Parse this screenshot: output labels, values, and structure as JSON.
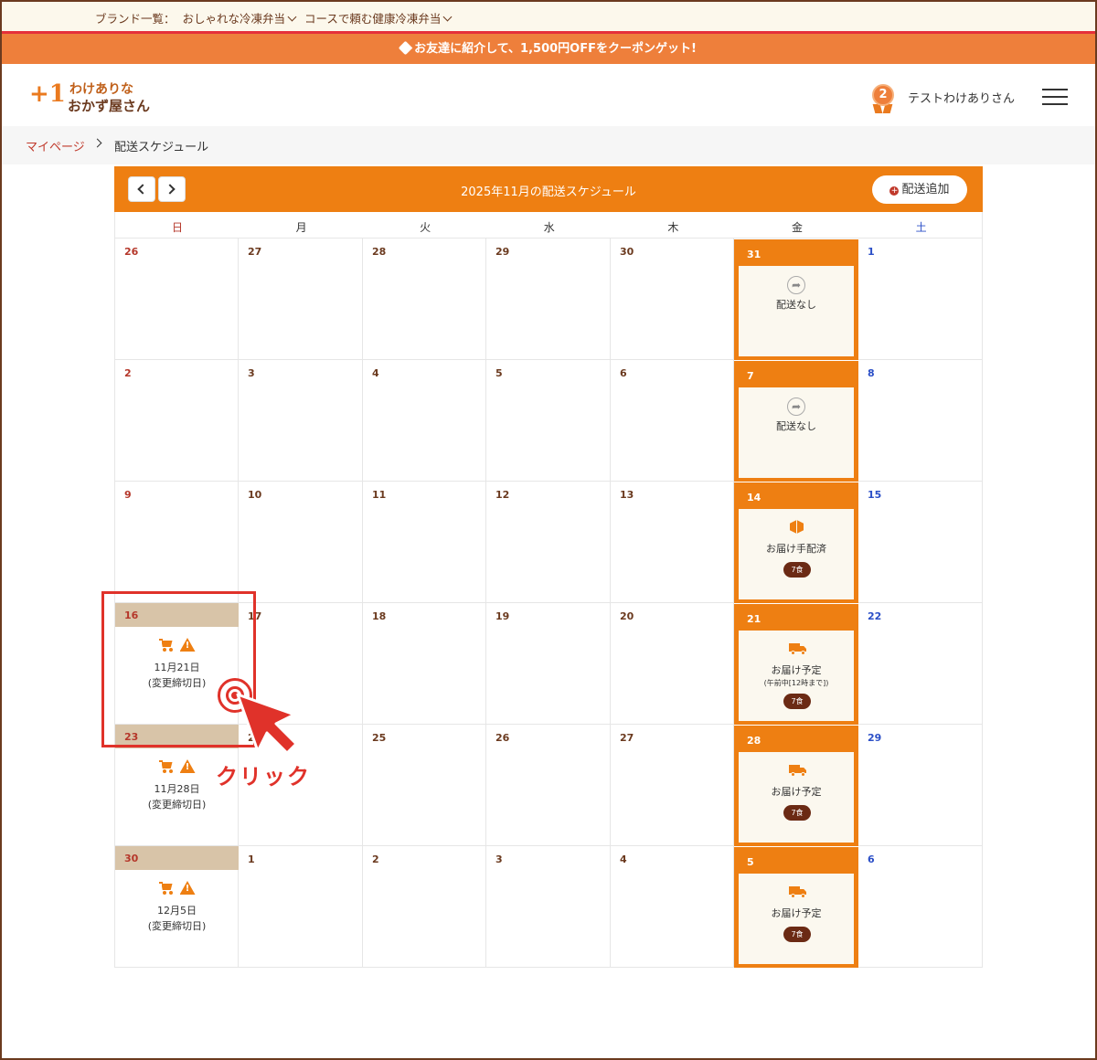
{
  "brand_bar": {
    "label": "ブランド一覧：",
    "links": [
      "おしゃれな冷凍弁当",
      "コースで頼む健康冷凍弁当"
    ]
  },
  "promo": {
    "text": "お友達に紹介して、1,500円OFFをクーポンゲット!"
  },
  "header": {
    "logo_plus": "+1",
    "logo_line1": "わけありな",
    "logo_line2": "おかず屋さん",
    "rank": "2",
    "user_name": "テストわけありさん"
  },
  "breadcrumb": {
    "home": "マイページ",
    "current": "配送スケジュール"
  },
  "calendar": {
    "title": "2025年11月の配送スケジュール",
    "add_button": "配送追加",
    "weekdays": [
      "日",
      "月",
      "火",
      "水",
      "木",
      "金",
      "土"
    ],
    "weeks": [
      [
        {
          "day": "26"
        },
        {
          "day": "27"
        },
        {
          "day": "28"
        },
        {
          "day": "29"
        },
        {
          "day": "30"
        },
        {
          "day": "31",
          "status": "配送なし",
          "icon": "share-icon"
        },
        {
          "day": "1"
        }
      ],
      [
        {
          "day": "2"
        },
        {
          "day": "3"
        },
        {
          "day": "4"
        },
        {
          "day": "5"
        },
        {
          "day": "6"
        },
        {
          "day": "7",
          "status": "配送なし",
          "icon": "share-icon"
        },
        {
          "day": "8"
        }
      ],
      [
        {
          "day": "9"
        },
        {
          "day": "10"
        },
        {
          "day": "11"
        },
        {
          "day": "12"
        },
        {
          "day": "13"
        },
        {
          "day": "14",
          "status": "お届け手配済",
          "icon": "package-icon",
          "meals": "7食"
        },
        {
          "day": "15"
        }
      ],
      [
        {
          "day": "16",
          "deadline_date": "11月21日",
          "deadline_label": "(変更締切日)"
        },
        {
          "day": "17"
        },
        {
          "day": "18"
        },
        {
          "day": "19"
        },
        {
          "day": "20"
        },
        {
          "day": "21",
          "status": "お届け予定",
          "icon": "truck-icon",
          "time": "(午前中[12時まで])",
          "meals": "7食"
        },
        {
          "day": "22"
        }
      ],
      [
        {
          "day": "23",
          "deadline_date": "11月28日",
          "deadline_label": "(変更締切日)"
        },
        {
          "day": "24"
        },
        {
          "day": "25"
        },
        {
          "day": "26"
        },
        {
          "day": "27"
        },
        {
          "day": "28",
          "status": "お届け予定",
          "icon": "truck-icon",
          "meals": "7食"
        },
        {
          "day": "29"
        }
      ],
      [
        {
          "day": "30",
          "deadline_date": "12月5日",
          "deadline_label": "(変更締切日)"
        },
        {
          "day": "1"
        },
        {
          "day": "2"
        },
        {
          "day": "3"
        },
        {
          "day": "4"
        },
        {
          "day": "5",
          "status": "お届け予定",
          "icon": "truck-icon",
          "meals": "7食"
        },
        {
          "day": "6"
        }
      ]
    ]
  },
  "annotation": {
    "text": "クリック"
  },
  "colors": {
    "accent": "#ee7f12",
    "promo": "#ee7f3b",
    "annotation": "#e0322a",
    "deadline_header": "#d8c4a8",
    "pill": "#6b2a14"
  }
}
